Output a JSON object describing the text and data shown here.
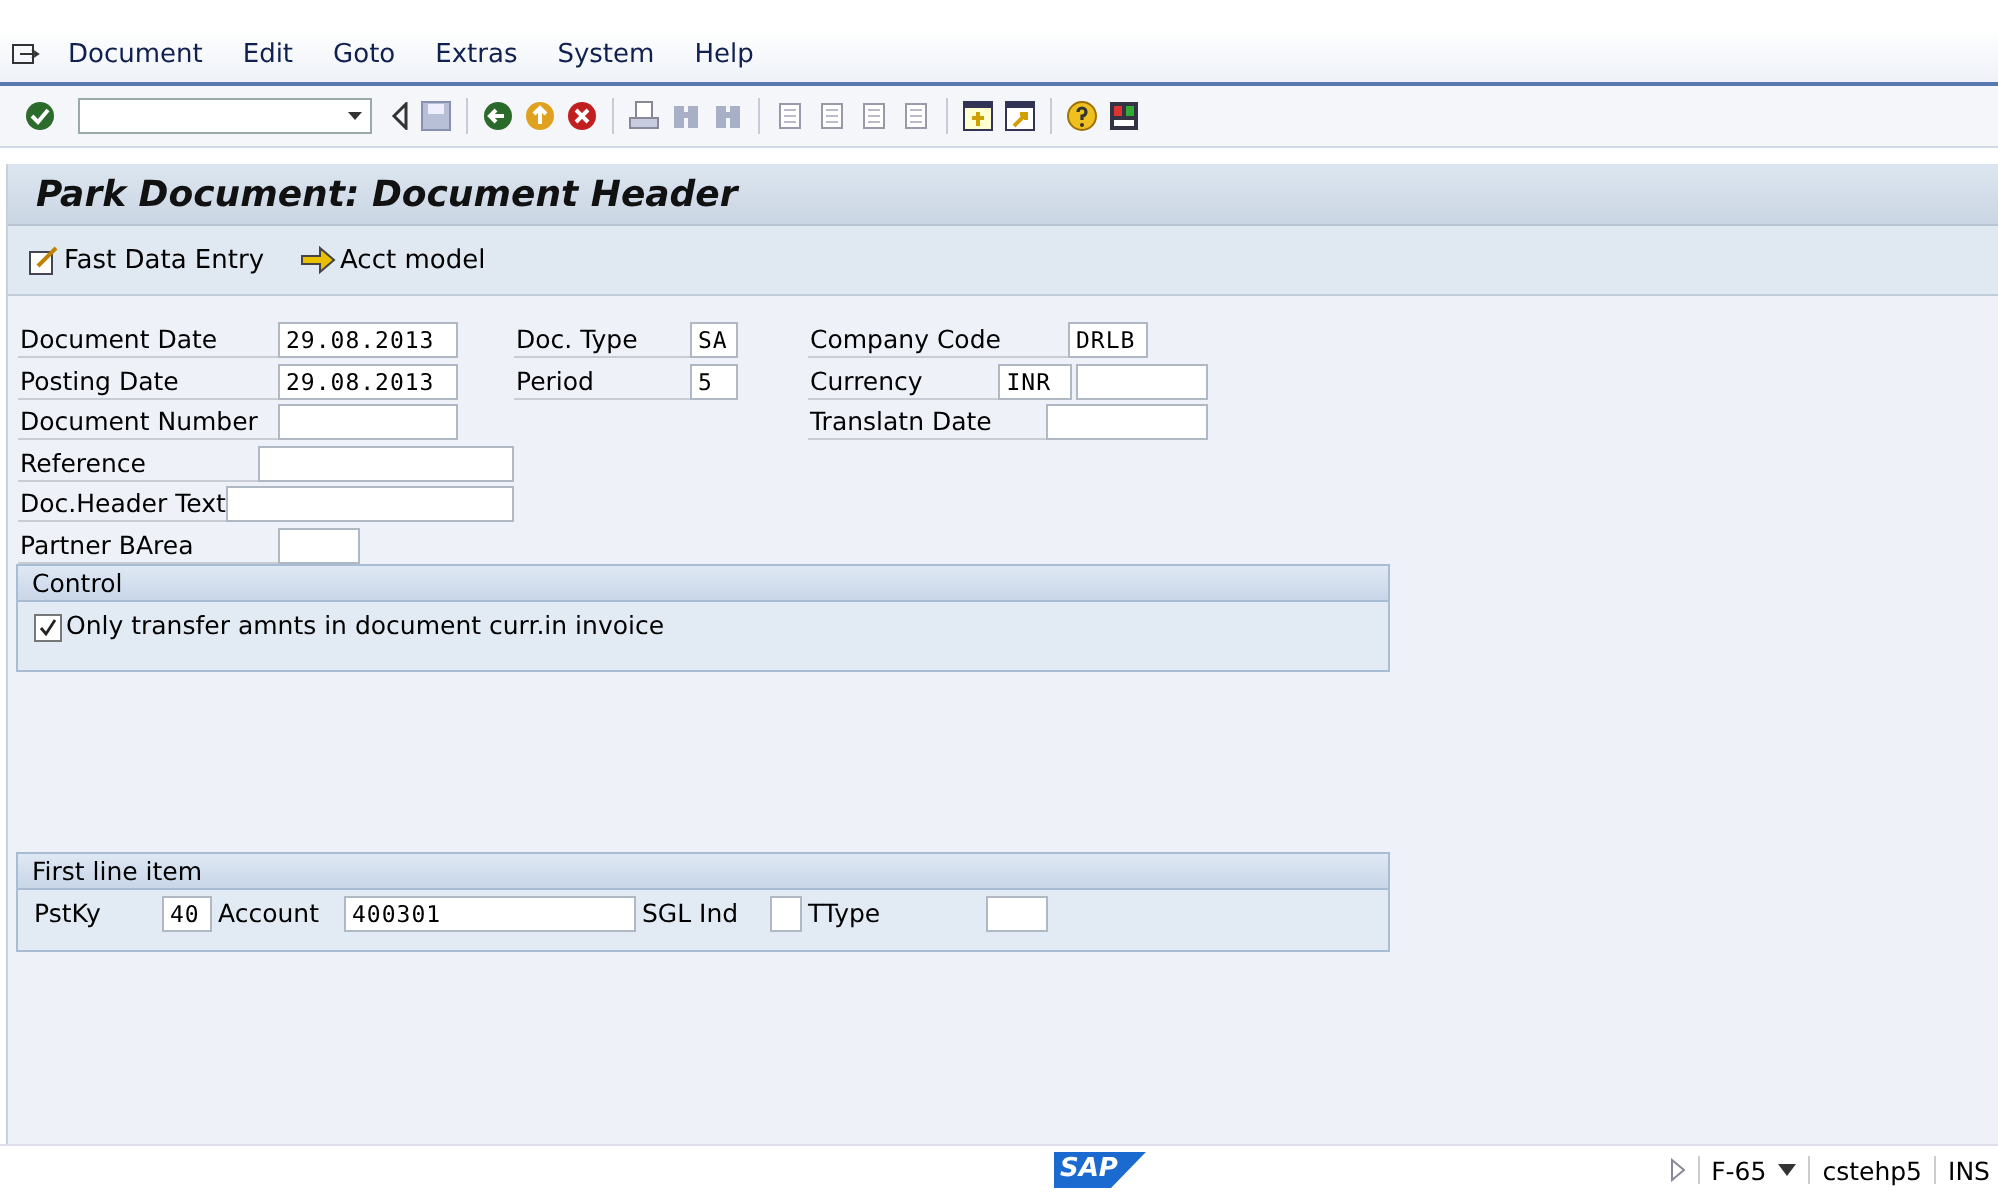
{
  "menu": [
    "Document",
    "Edit",
    "Goto",
    "Extras",
    "System",
    "Help"
  ],
  "title": "Park Document: Document Header",
  "app_toolbar": [
    "Fast Data Entry",
    "Acct model"
  ],
  "header_fields": {
    "column_1": [
      {
        "label": "Document Date",
        "value": "29.08.2013"
      },
      {
        "label": "Posting Date",
        "value": "29.08.2013"
      },
      {
        "label": "Document Number"
      },
      {
        "label": "Reference"
      },
      {
        "label": "Doc.Header Text"
      },
      {
        "label": "Partner BArea"
      }
    ],
    "column_2": [
      {
        "label": "Doc. Type",
        "value": "SA"
      },
      {
        "label": "Period",
        "value": "5"
      }
    ],
    "column_3": [
      {
        "label": "Company Code",
        "value": "DRLB"
      },
      {
        "label": "Currency",
        "value": "INR",
        "kind": "double"
      },
      {
        "label": "Translatn Date"
      }
    ]
  },
  "control": {
    "title": "Control",
    "checkbox": {
      "label": "Only transfer amnts in document curr.in invoice",
      "checked": true
    }
  },
  "first_line_item": {
    "title": "First line item",
    "fields": [
      {
        "label": "PstKy",
        "value": "40"
      },
      {
        "label": "Account",
        "value": "400301"
      },
      {
        "label": "SGL Ind"
      },
      {
        "label": "TType"
      }
    ]
  },
  "status_bar": {
    "logo": "SAP",
    "transaction": "F-65",
    "server": "cstehp5",
    "mode": "INS"
  }
}
